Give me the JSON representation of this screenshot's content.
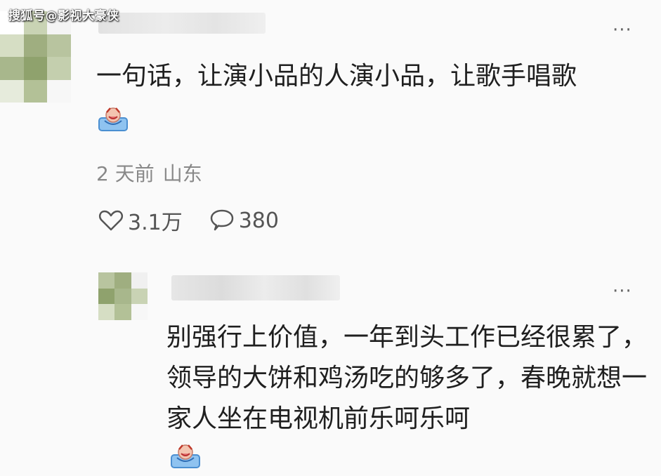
{
  "watermark": "搜狐号@影视大豪侠",
  "comment": {
    "text": "一句话，让演小品的人演小品，让歌手唱歌",
    "emoji": "laughing-crying-emoji",
    "time": "2 天前",
    "location": "山东",
    "likes": "3.1万",
    "replies": "380",
    "more_label": "···"
  },
  "reply": {
    "text": "别强行上价值，一年到头工作已经很累了，领导的大饼和鸡汤吃的够多了，春晚就想一家人坐在电视机前乐呵乐呵",
    "emoji": "laughing-crying-emoji",
    "more_label": "···"
  },
  "colors": {
    "background": "#fafafa",
    "text": "#1f1f1f",
    "meta": "#888888"
  }
}
